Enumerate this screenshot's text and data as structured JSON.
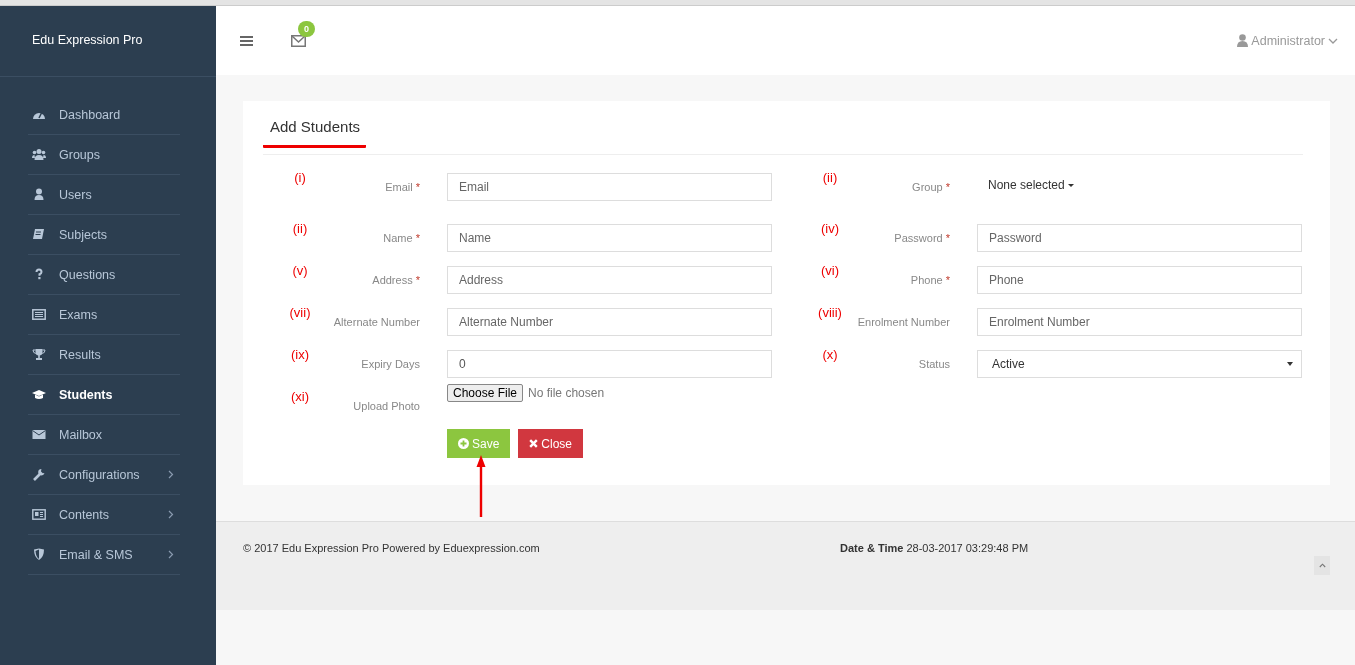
{
  "sidebar": {
    "brand": "Edu Expression Pro",
    "items": [
      {
        "label": "Dashboard",
        "selected": false,
        "submenu": false
      },
      {
        "label": "Groups",
        "selected": false,
        "submenu": false
      },
      {
        "label": "Users",
        "selected": false,
        "submenu": false
      },
      {
        "label": "Subjects",
        "selected": false,
        "submenu": false
      },
      {
        "label": "Questions",
        "selected": false,
        "submenu": false
      },
      {
        "label": "Exams",
        "selected": false,
        "submenu": false
      },
      {
        "label": "Results",
        "selected": false,
        "submenu": false
      },
      {
        "label": "Students",
        "selected": true,
        "submenu": false
      },
      {
        "label": "Mailbox",
        "selected": false,
        "submenu": false
      },
      {
        "label": "Configurations",
        "selected": false,
        "submenu": true
      },
      {
        "label": "Contents",
        "selected": false,
        "submenu": true
      },
      {
        "label": "Email & SMS",
        "selected": false,
        "submenu": true
      }
    ]
  },
  "header": {
    "mail_count": "0",
    "user": "Administrator"
  },
  "panel": {
    "title": "Add Students",
    "fields": [
      {
        "marker": "(i)",
        "label": "Email",
        "required": "*",
        "kind": "input",
        "placeholder": "Email"
      },
      {
        "marker": "(ii)",
        "label": "Group",
        "required": "*",
        "kind": "multiselect",
        "value": "None selected"
      },
      {
        "marker": "(ii)",
        "label": "Name",
        "required": "*",
        "kind": "input",
        "placeholder": "Name"
      },
      {
        "marker": "(iv)",
        "label": "Password",
        "required": "*",
        "kind": "input",
        "placeholder": "Password"
      },
      {
        "marker": "(v)",
        "label": "Address",
        "required": "*",
        "kind": "input",
        "placeholder": "Address"
      },
      {
        "marker": "(vi)",
        "label": "Phone",
        "required": "*",
        "kind": "input",
        "placeholder": "Phone"
      },
      {
        "marker": "(vii)",
        "label": "Alternate Number",
        "kind": "input",
        "placeholder": "Alternate Number"
      },
      {
        "marker": "(viii)",
        "label": "Enrolment Number",
        "kind": "input",
        "placeholder": "Enrolment Number"
      },
      {
        "marker": "(ix)",
        "label": "Expiry Days",
        "kind": "input",
        "value": "0"
      },
      {
        "marker": "(x)",
        "label": "Status",
        "kind": "select",
        "value": "Active"
      },
      {
        "marker": "(xi)",
        "label": "Upload Photo",
        "kind": "file",
        "button": "Choose File",
        "status": "No file chosen"
      }
    ],
    "buttons": [
      {
        "label": "Save",
        "kind": "save"
      },
      {
        "label": "Close",
        "kind": "close"
      }
    ]
  },
  "footer": {
    "copyright": "© 2017 Edu Expression Pro Powered by Eduexpression.com",
    "datetime": "**Date & Time** 28-03-2017 03:29:48 PM"
  }
}
